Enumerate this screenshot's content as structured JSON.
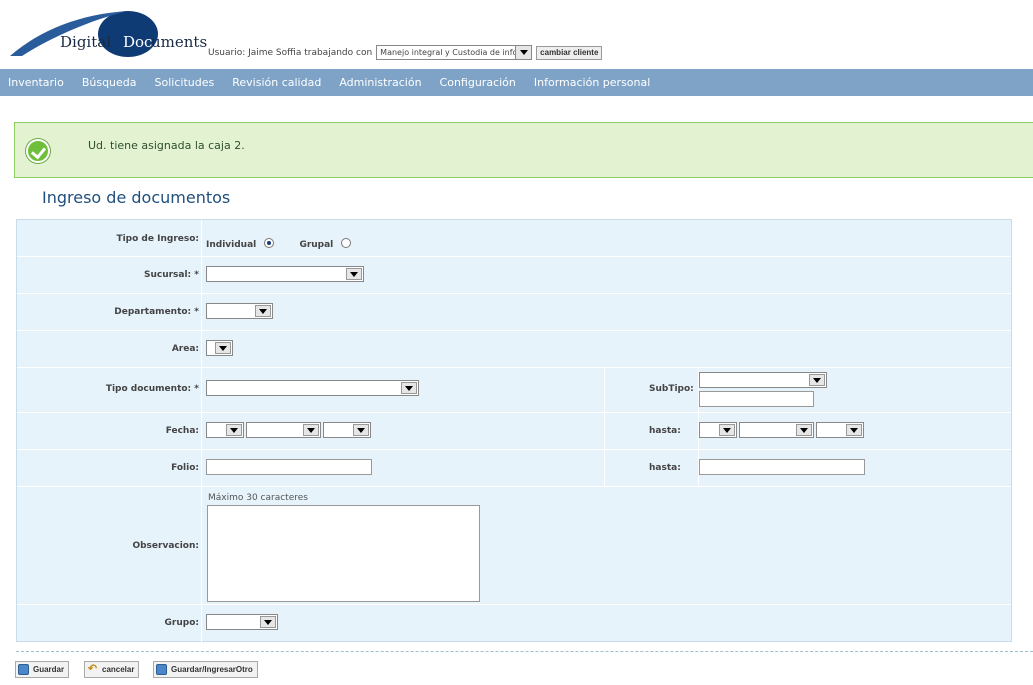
{
  "app": {
    "logo_word1": "Digital",
    "logo_word2": "Doc",
    "logo_word3": "uments",
    "user_text": "Usuario: Jaime Soffia trabajando con",
    "client_select": "Manejo integral y Custodia de informac",
    "change_client": "cambiar cliente"
  },
  "nav": [
    "Inventario",
    "Búsqueda",
    "Solicitudes",
    "Revisión calidad",
    "Administración",
    "Configuración",
    "Información personal"
  ],
  "alert": {
    "message": "Ud. tiene asignada la caja 2."
  },
  "page_title": "Ingreso de documentos",
  "form": {
    "tipo_ingreso": "Tipo de Ingreso:",
    "individual": "Individual",
    "grupal": "Grupal",
    "sucursal": "Sucursal: *",
    "departamento": "Departamento: *",
    "area": "Area:",
    "tipo_documento": "Tipo documento: *",
    "subtipo": "SubTipo:",
    "fecha": "Fecha:",
    "hasta": "hasta:",
    "folio": "Folio:",
    "hasta2": "hasta:",
    "observacion": "Observacion:",
    "obs_hint": "Máximo 30 caracteres",
    "grupo": "Grupo:"
  },
  "actions": {
    "save": "Guardar",
    "cancel": "cancelar",
    "save_next": "Guardar/IngresarOtro"
  },
  "colors": {
    "nav_bg": "#7ea3c7",
    "alert_bg": "#e3f3d2",
    "form_bg": "#e6f3fb"
  }
}
